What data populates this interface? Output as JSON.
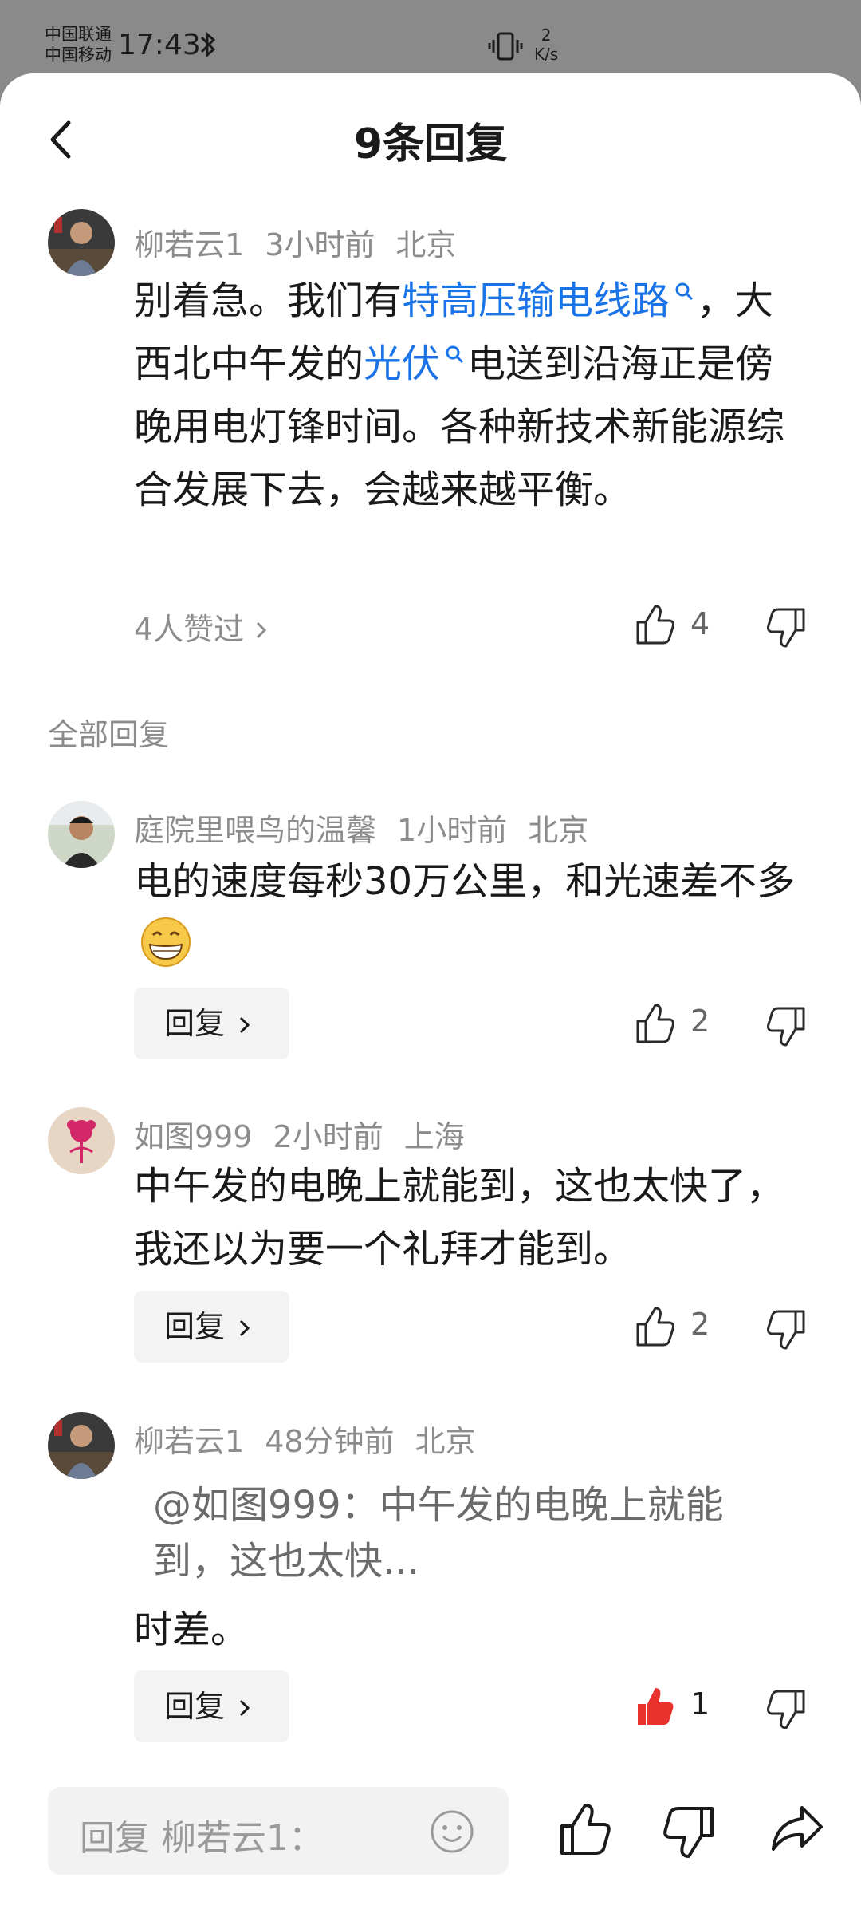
{
  "status_bar": {
    "carrier1": "中国联通",
    "carrier2": "中国移动",
    "time": "17:43",
    "net_speed_value": "2",
    "net_speed_unit": "K/s"
  },
  "header": {
    "title": "9条回复"
  },
  "main_comment": {
    "username": "柳若云1",
    "time": "3小时前",
    "location": "北京",
    "text_part1": "别着急。我们有",
    "link1": "特高压输电线路",
    "text_part2": "，大西北中午发的",
    "link2": "光伏",
    "text_part3": "电送到沿海正是傍晚用电灯锋时间。各种新技术新能源综合发展下去，会越来越平衡。",
    "likers_label": "4人赞过",
    "like_count": "4"
  },
  "section_label": "全部回复",
  "replies": [
    {
      "username": "庭院里喂鸟的温馨",
      "time": "1小时前",
      "location": "北京",
      "text": "电的速度每秒30万公里，和光速差不多",
      "reply_label": "回复",
      "like_count": "2"
    },
    {
      "username": "如图999",
      "time": "2小时前",
      "location": "上海",
      "text": "中午发的电晚上就能到，这也太快了，我还以为要一个礼拜才能到。",
      "reply_label": "回复",
      "like_count": "2"
    },
    {
      "username": "柳若云1",
      "time": "48分钟前",
      "location": "北京",
      "quote": "@如图999：中午发的电晚上就能到，这也太快...",
      "text": "时差。",
      "reply_label": "回复",
      "like_count": "1"
    }
  ],
  "bottom_bar": {
    "input_placeholder": "回复 柳若云1："
  },
  "colors": {
    "link": "#1a74e8",
    "liked": "#e8322e",
    "meta": "#8c8c8c"
  }
}
